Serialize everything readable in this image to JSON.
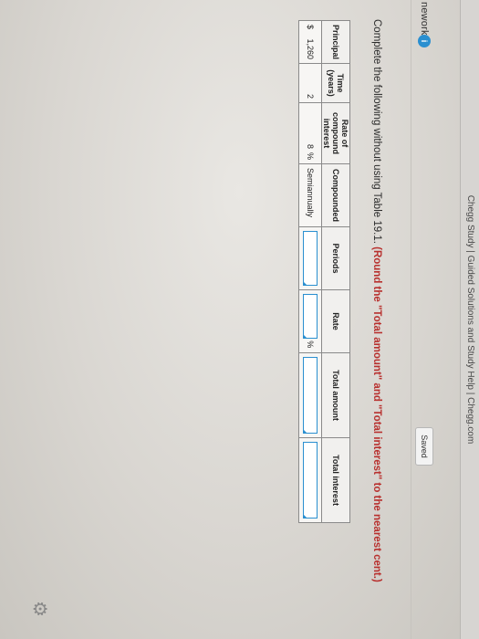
{
  "browser": {
    "tab_title": "Chegg Study | Guided Solutions and Study Help | Chegg.com"
  },
  "header": {
    "homework_label": "nework",
    "badge": "i",
    "saved_label": "Saved"
  },
  "question": {
    "instruction_plain": "Complete the following without using Table 19.1. ",
    "instruction_bold": "(Round the \"Total amount\" and \"Total interest\" to the nearest cent.)"
  },
  "table": {
    "headers": [
      "Principal",
      "Time (years)",
      "Rate of compound interest",
      "Compounded",
      "Periods",
      "Rate",
      "Total amount",
      "Total interest"
    ],
    "row": {
      "currency": "$",
      "principal": "1,260",
      "time": "2",
      "rate_value": "8",
      "rate_unit": "%",
      "compounded": "Semiannually",
      "periods_value": "",
      "rate_input_value": "",
      "rate_input_unit": "%",
      "total_amount_value": "",
      "total_interest_value": ""
    }
  },
  "colors": {
    "accent": "#2a8fd0",
    "instruction_bold": "#b8312f"
  },
  "icons": {
    "settings": "gear-icon"
  }
}
